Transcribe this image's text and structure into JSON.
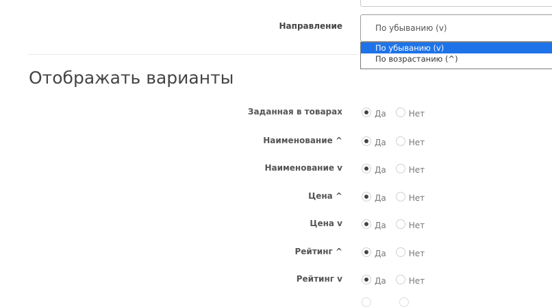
{
  "direction": {
    "label": "Направление",
    "value": "По убыванию (v)",
    "options": [
      "По убыванию (v)",
      "По возрастанию (^)"
    ],
    "selected_index": 0
  },
  "section": {
    "title": "Отображать варианты"
  },
  "radio_text": {
    "yes": "Да",
    "no": "Нет"
  },
  "rows": [
    {
      "label": "Заданная в товарах",
      "value": "Да"
    },
    {
      "label": "Наименование ^",
      "value": "Да"
    },
    {
      "label": "Наименование v",
      "value": "Да"
    },
    {
      "label": "Цена ^",
      "value": "Да"
    },
    {
      "label": "Цена v",
      "value": "Да"
    },
    {
      "label": "Рейтинг ^",
      "value": "Да"
    },
    {
      "label": "Рейтинг v",
      "value": "Да"
    }
  ]
}
